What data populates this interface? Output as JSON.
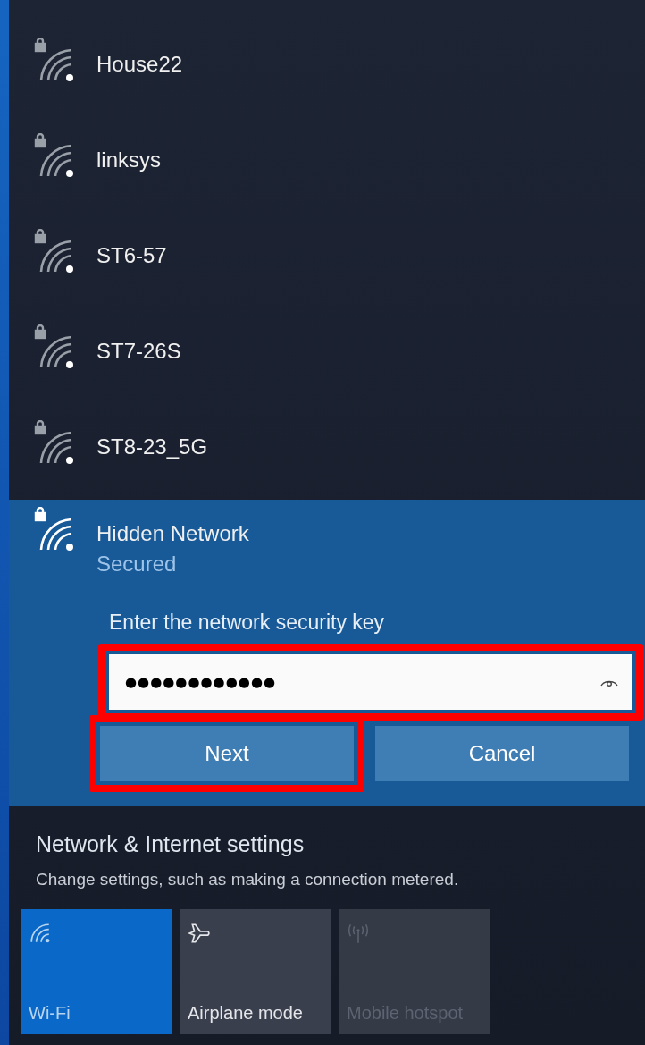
{
  "networks": [
    {
      "name": "House22",
      "secured": true,
      "selected": false
    },
    {
      "name": "linksys",
      "secured": true,
      "selected": false
    },
    {
      "name": "ST6-57",
      "secured": true,
      "selected": false
    },
    {
      "name": "ST7-26S",
      "secured": true,
      "selected": false
    },
    {
      "name": "ST8-23_5G",
      "secured": true,
      "selected": false
    },
    {
      "name": "Hidden Network",
      "secured": true,
      "selected": true,
      "status": "Secured",
      "key_label": "Enter the network security key",
      "key_value": "●●●●●●●●●●●●",
      "key_highlighted": true,
      "buttons": [
        {
          "label": "Next",
          "highlighted": true
        },
        {
          "label": "Cancel",
          "highlighted": false
        }
      ]
    }
  ],
  "settings": {
    "title": "Network & Internet settings",
    "subtitle": "Change settings, such as making a connection metered."
  },
  "quick_actions": [
    {
      "kind": "wifi",
      "label": "Wi-Fi",
      "on": true,
      "disabled": false
    },
    {
      "kind": "airplane",
      "label": "Airplane mode",
      "on": false,
      "disabled": false
    },
    {
      "kind": "hotspot",
      "label": "Mobile hotspot",
      "on": false,
      "disabled": true
    }
  ]
}
